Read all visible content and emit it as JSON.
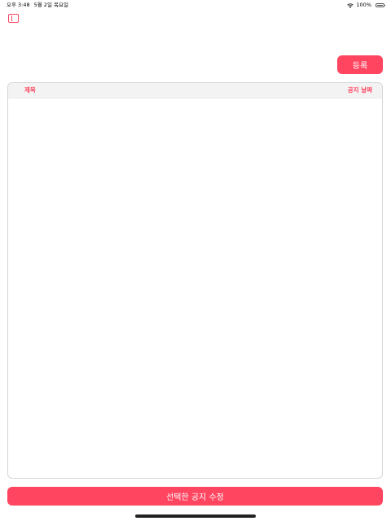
{
  "status_bar": {
    "time": "오후 3:48",
    "date": "5월 2일 목요일",
    "battery": "100%"
  },
  "toolbar": {
    "register_label": "등록"
  },
  "table": {
    "columns": [
      "제목",
      "공지 날짜"
    ],
    "rows": []
  },
  "actions": {
    "edit_selected_label": "선택한 공지 수정"
  },
  "colors": {
    "accent": "#ff4560",
    "header_bg": "#f3f3f3",
    "border": "#d6d6d6"
  },
  "icons": {
    "sidebar_toggle": "sidebar-icon",
    "wifi": "wifi-icon",
    "battery": "battery-icon"
  }
}
